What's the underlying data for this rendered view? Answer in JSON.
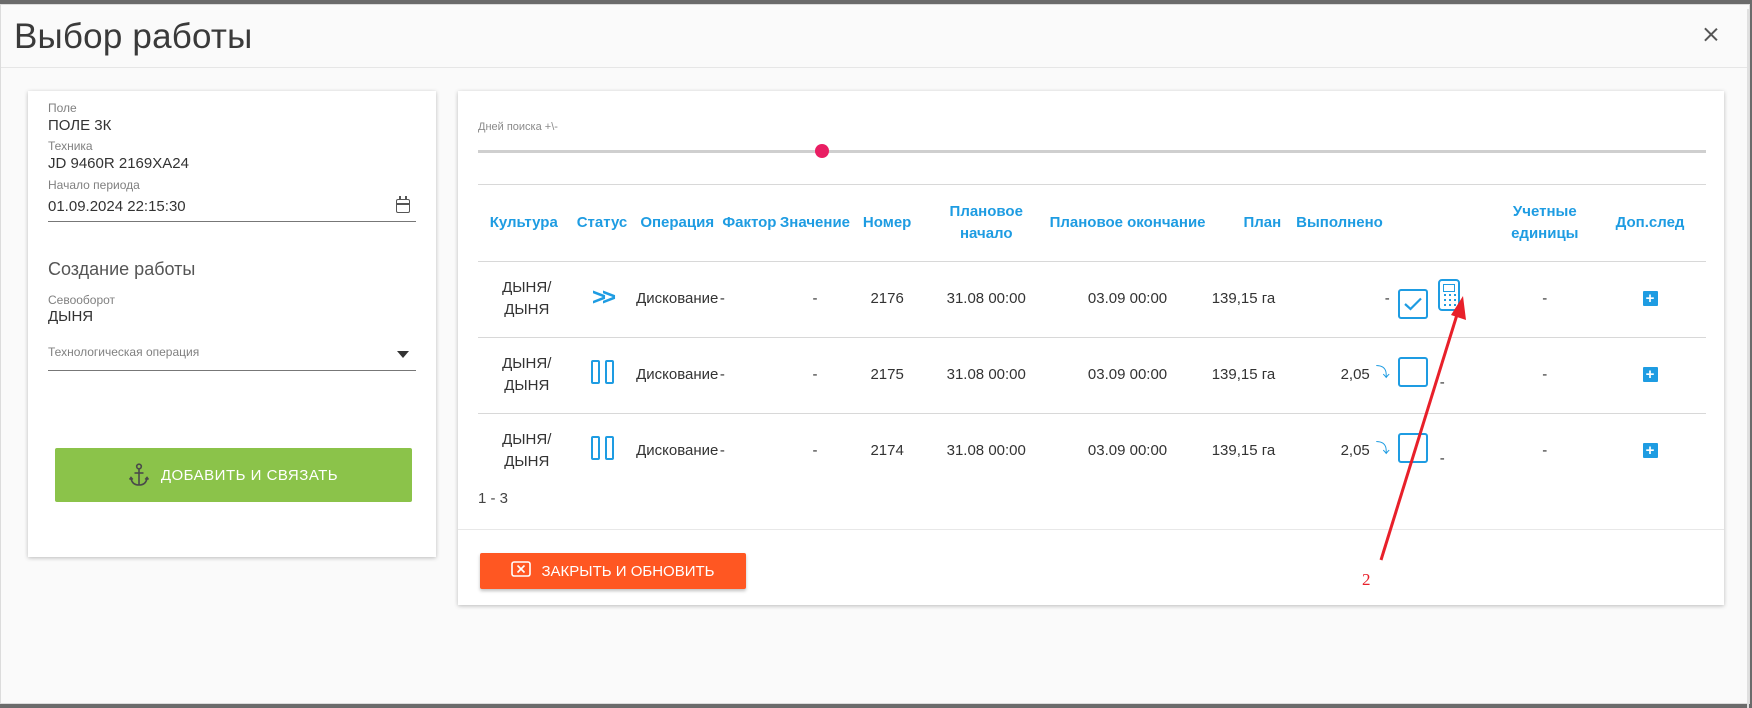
{
  "modal": {
    "title": "Выбор работы"
  },
  "left": {
    "field_label": "Поле",
    "field_value": "ПОЛЕ 3К",
    "tech_label": "Техника",
    "tech_value": "JD 9460R 2169ХА24",
    "period_label": "Начало периода",
    "period_value": "01.09.2024 22:15:30",
    "create_title": "Создание работы",
    "crop_label": "Севооборот",
    "crop_value": "ДЫНЯ",
    "operation_label": "Технологическая операция",
    "operation_value": "",
    "add_button": "ДОБАВИТЬ И СВЯЗАТЬ"
  },
  "right": {
    "slider_label": "Дней поиска +\\-",
    "slider_value": 0.28,
    "columns": [
      "Культура",
      "Статус",
      "Операция",
      "Фактор",
      "Значение",
      "Номер",
      "Плановое начало",
      "Плановое окончание",
      "План",
      "Выполнено",
      "",
      "Учетные единицы",
      "Доп.след"
    ],
    "rows": [
      {
        "culture": "ДЫНЯ/ ДЫНЯ",
        "status": "play",
        "operation": "Дискование",
        "factor": "-",
        "value": "-",
        "number": "2176",
        "plan_start": "31.08 00:00",
        "plan_end": "03.09 00:00",
        "plan": "139,15 га",
        "done": "-",
        "done_arrow": false,
        "checked": true,
        "calc": true,
        "units": "-"
      },
      {
        "culture": "ДЫНЯ/ ДЫНЯ",
        "status": "pause",
        "operation": "Дискование",
        "factor": "-",
        "value": "-",
        "number": "2175",
        "plan_start": "31.08 00:00",
        "plan_end": "03.09 00:00",
        "plan": "139,15 га",
        "done": "2,05",
        "done_arrow": true,
        "checked": false,
        "calc": false,
        "units": "-"
      },
      {
        "culture": "ДЫНЯ/ ДЫНЯ",
        "status": "pause",
        "operation": "Дискование",
        "factor": "-",
        "value": "-",
        "number": "2174",
        "plan_start": "31.08 00:00",
        "plan_end": "03.09 00:00",
        "plan": "139,15 га",
        "done": "2,05",
        "done_arrow": true,
        "checked": false,
        "calc": false,
        "units": "-"
      }
    ],
    "pagination": "1 - 3",
    "close_button": "ЗАКРЫТЬ И ОБНОВИТЬ"
  },
  "annotation": {
    "label": "2",
    "color": "#e8202a"
  },
  "colors": {
    "accent": "#1e9ce2",
    "green": "#8bc34a",
    "orange": "#ff5722",
    "pink": "#e91e63"
  }
}
